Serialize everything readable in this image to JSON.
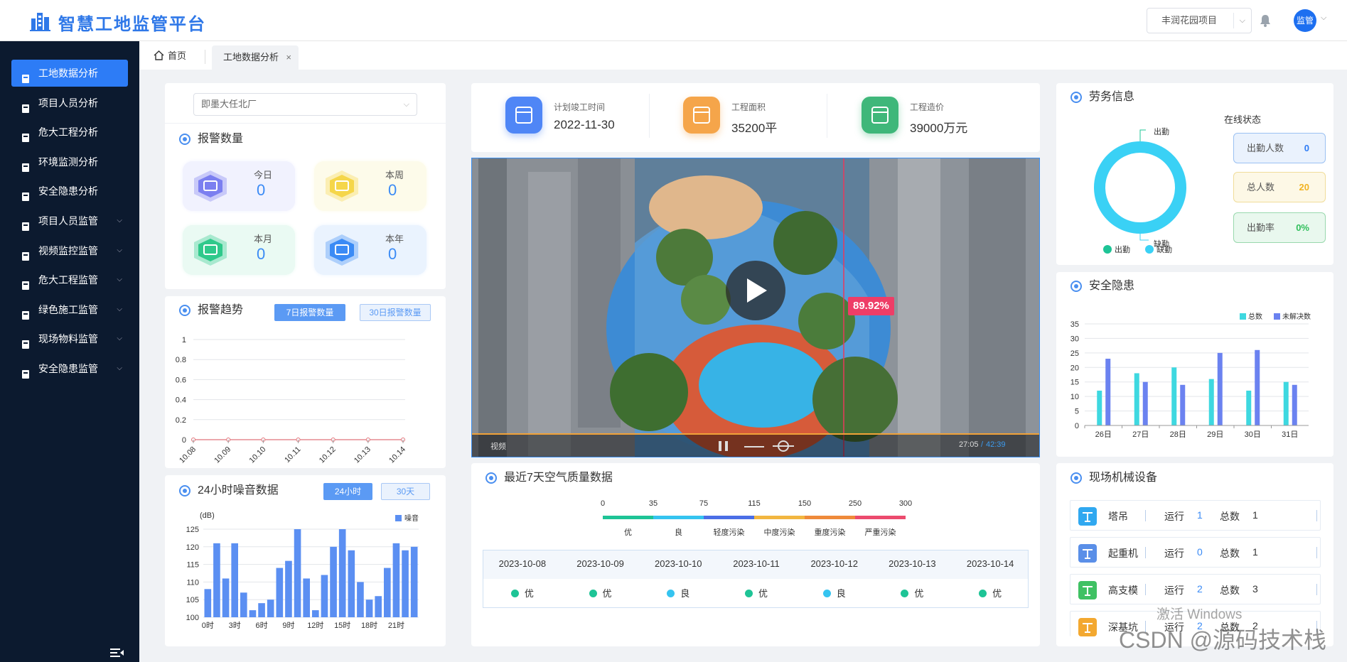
{
  "header": {
    "app_title": "智慧工地监管平台",
    "project_select": "丰润花园项目",
    "avatar_text": "监管"
  },
  "sidebar": {
    "items": [
      {
        "label": "工地数据分析",
        "icon": "building-icon",
        "active": true,
        "expandable": false
      },
      {
        "label": "项目人员分析",
        "icon": "person-icon",
        "active": false,
        "expandable": false
      },
      {
        "label": "危大工程分析",
        "icon": "filter-icon",
        "active": false,
        "expandable": false
      },
      {
        "label": "环境监测分析",
        "icon": "pie-icon",
        "active": false,
        "expandable": false
      },
      {
        "label": "安全隐患分析",
        "icon": "bar-icon",
        "active": false,
        "expandable": false
      },
      {
        "label": "项目人员监管",
        "icon": "people-icon",
        "active": false,
        "expandable": true
      },
      {
        "label": "视频监控监管",
        "icon": "camera-icon",
        "active": false,
        "expandable": true
      },
      {
        "label": "危大工程监管",
        "icon": "toolbox-icon",
        "active": false,
        "expandable": true
      },
      {
        "label": "绿色施工监管",
        "icon": "leaf-icon",
        "active": false,
        "expandable": true
      },
      {
        "label": "现场物料监管",
        "icon": "truck-icon",
        "active": false,
        "expandable": true
      },
      {
        "label": "安全隐患监管",
        "icon": "shield-icon",
        "active": false,
        "expandable": true
      }
    ]
  },
  "tabs": {
    "home": "首页",
    "active": "工地数据分析",
    "close": "×"
  },
  "site_select": "即墨大任北厂",
  "alarm": {
    "title": "报警数量",
    "cards": [
      {
        "label": "今日",
        "value": "0",
        "color": "#7b7ff0"
      },
      {
        "label": "本周",
        "value": "0",
        "color": "#f5d64a"
      },
      {
        "label": "本月",
        "value": "0",
        "color": "#2fc98b"
      },
      {
        "label": "本年",
        "value": "0",
        "color": "#3b8bf5"
      }
    ]
  },
  "trend": {
    "title": "报警趋势",
    "btn_7": "7日报警数量",
    "btn_30": "30日报警数量"
  },
  "noise": {
    "title": "24小时噪音数据",
    "btn_24": "24小时",
    "btn_30": "30天"
  },
  "stats": [
    {
      "label": "计划竣工时间",
      "value": "2022-11-30",
      "color": "#4f86f6",
      "icon": "calendar-icon"
    },
    {
      "label": "工程面积",
      "value": "35200平",
      "color": "#f5a54a",
      "icon": "area-icon"
    },
    {
      "label": "工程造价",
      "value": "39000万元",
      "color": "#3fb77a",
      "icon": "money-shield-icon"
    }
  ],
  "video": {
    "percent_badge": "89.92%",
    "label": "视频",
    "time_current": "27:05",
    "time_total": "42:39"
  },
  "aqi": {
    "title": "最近7天空气质量数据",
    "scale_values": [
      "0",
      "35",
      "75",
      "115",
      "150",
      "250",
      "300"
    ],
    "levels": [
      {
        "label": "优",
        "color": "#1ec496"
      },
      {
        "label": "良",
        "color": "#35c4f0"
      },
      {
        "label": "轻度污染",
        "color": "#4b6ee6"
      },
      {
        "label": "中度污染",
        "color": "#f2b640"
      },
      {
        "label": "重度污染",
        "color": "#ef8a3a"
      },
      {
        "label": "严重污染",
        "color": "#ec4b6e"
      }
    ],
    "days": [
      {
        "date": "2023-10-08",
        "level": "优",
        "color": "#1ec496"
      },
      {
        "date": "2023-10-09",
        "level": "优",
        "color": "#1ec496"
      },
      {
        "date": "2023-10-10",
        "level": "良",
        "color": "#35c4f0"
      },
      {
        "date": "2023-10-11",
        "level": "优",
        "color": "#1ec496"
      },
      {
        "date": "2023-10-12",
        "level": "良",
        "color": "#35c4f0"
      },
      {
        "date": "2023-10-13",
        "level": "优",
        "color": "#1ec496"
      },
      {
        "date": "2023-10-14",
        "level": "优",
        "color": "#1ec496"
      }
    ]
  },
  "labour": {
    "title": "劳务信息",
    "online_status": "在线状态",
    "donut_labels": [
      "出勤",
      "缺勤"
    ],
    "legend": [
      "出勤",
      "缺勤"
    ],
    "boxes": [
      {
        "label": "出勤人数",
        "value": "0",
        "bg": "#eaf2fd",
        "border": "#9bc1f2",
        "vcolor": "#2d7cf6"
      },
      {
        "label": "总人数",
        "value": "20",
        "bg": "#fdf8e6",
        "border": "#f0dd9a",
        "vcolor": "#f2b321"
      },
      {
        "label": "出勤率",
        "value": "0%",
        "bg": "#e9f8ee",
        "border": "#99d8ad",
        "vcolor": "#2fbf5b"
      }
    ]
  },
  "safety": {
    "title": "安全隐患"
  },
  "machines": {
    "title": "现场机械设备",
    "run_label": "运行",
    "total_label": "总数",
    "items": [
      {
        "name": "塔吊",
        "run": "1",
        "total": "1",
        "color": "#30a8f0",
        "icon": "tower-crane-icon"
      },
      {
        "name": "起重机",
        "run": "0",
        "total": "1",
        "color": "#5a8fe8",
        "icon": "crane-icon"
      },
      {
        "name": "高支模",
        "run": "2",
        "total": "3",
        "color": "#3fc163",
        "icon": "formwork-icon"
      },
      {
        "name": "深基坑",
        "run": "2",
        "total": "2",
        "color": "#f3a830",
        "icon": "pit-icon"
      }
    ]
  },
  "watermark": {
    "activate_line": "激活 Windows",
    "csdn": "CSDN @源码技术栈"
  },
  "chart_data": [
    {
      "type": "line",
      "title": "报警趋势",
      "x": [
        "10.08",
        "10.09",
        "10.10",
        "10.11",
        "10.12",
        "10.13",
        "10.14"
      ],
      "series": [
        {
          "values": [
            0,
            0,
            0,
            0,
            0,
            0,
            0
          ],
          "color": "#e0737a"
        }
      ],
      "yticks": [
        "0",
        "0.2",
        "0.4",
        "0.6",
        "0.8",
        "1"
      ],
      "ylim": [
        0,
        1
      ]
    },
    {
      "type": "bar",
      "title": "24小时噪音数据",
      "ylabel": "(dB)",
      "xticks": [
        "0时",
        "3时",
        "6时",
        "9时",
        "12时",
        "15时",
        "18时",
        "21时"
      ],
      "yticks": [
        "100",
        "105",
        "110",
        "115",
        "120",
        "125"
      ],
      "ylim": [
        100,
        125
      ],
      "series": [
        {
          "name": "噪音",
          "color": "#5b8ff2",
          "values": [
            108,
            121,
            111,
            121,
            107,
            102,
            104,
            105,
            114,
            116,
            125,
            111,
            102,
            112,
            120,
            125,
            119,
            110,
            105,
            106,
            114,
            121,
            119,
            120
          ]
        }
      ]
    },
    {
      "type": "bar",
      "title": "安全隐患",
      "categories": [
        "26日",
        "27日",
        "28日",
        "29日",
        "30日",
        "31日"
      ],
      "yticks": [
        "0",
        "5",
        "10",
        "15",
        "20",
        "25",
        "30",
        "35"
      ],
      "ylim": [
        0,
        35
      ],
      "series": [
        {
          "name": "总数",
          "color": "#3ed8e0",
          "values": [
            12,
            18,
            20,
            16,
            12,
            15
          ]
        },
        {
          "name": "未解决数",
          "color": "#6b82f0",
          "values": [
            23,
            15,
            14,
            25,
            26,
            14
          ]
        }
      ]
    },
    {
      "type": "pie",
      "title": "劳务信息",
      "categories": [
        "出勤",
        "缺勤"
      ],
      "values": [
        0,
        20
      ],
      "colors": [
        "#1ec496",
        "#3ad1f5"
      ]
    }
  ]
}
